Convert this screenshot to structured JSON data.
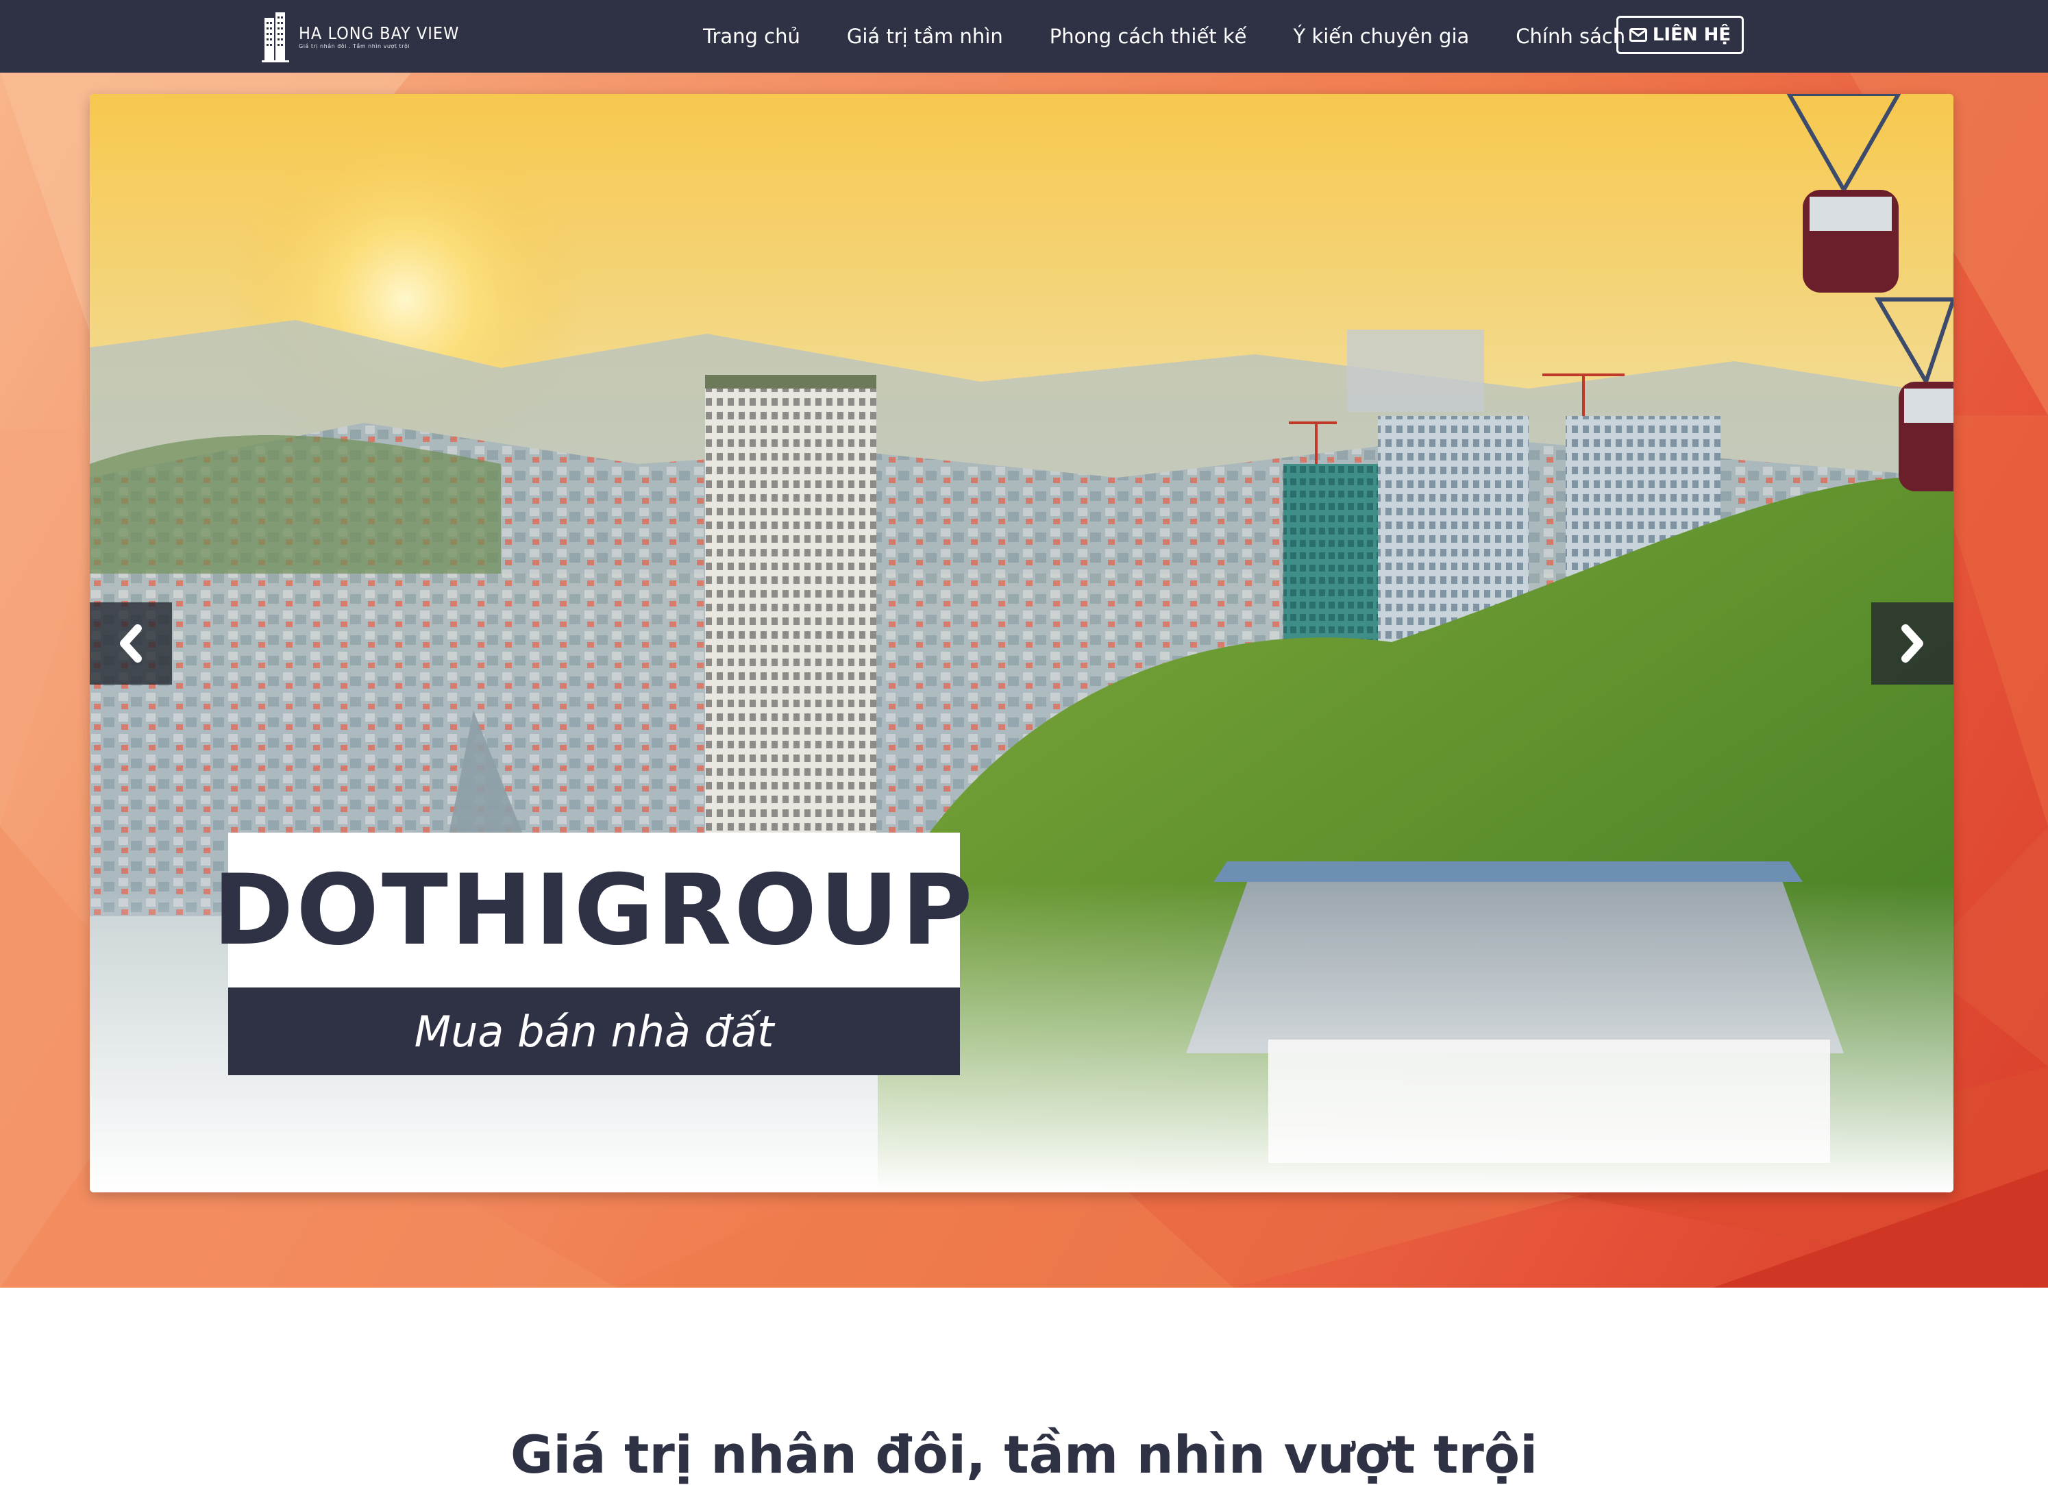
{
  "logo": {
    "title": "HA LONG BAY VIEW",
    "tagline": "Giá trị nhân đôi . Tầm nhìn vượt trội"
  },
  "nav": {
    "items": [
      {
        "label": "Trang chủ"
      },
      {
        "label": "Giá trị tầm nhìn"
      },
      {
        "label": "Phong cách thiết kế"
      },
      {
        "label": "Ý kiến chuyên gia"
      },
      {
        "label": "Chính sách"
      }
    ],
    "contact_label": "LIÊN HỆ",
    "contact_icon": "envelope-icon"
  },
  "hero": {
    "caption_title": "DOTHIGROUP",
    "caption_subtitle": "Mua bán nhà đất",
    "prev_icon": "chevron-left-icon",
    "next_icon": "chevron-right-icon"
  },
  "section": {
    "title": "Giá trị nhân đôi, tầm nhìn vượt trội"
  },
  "colors": {
    "navbar_bg": "#2e3244",
    "accent_orange": "#ef7a4d",
    "text_dark": "#2e3244",
    "white": "#ffffff"
  }
}
